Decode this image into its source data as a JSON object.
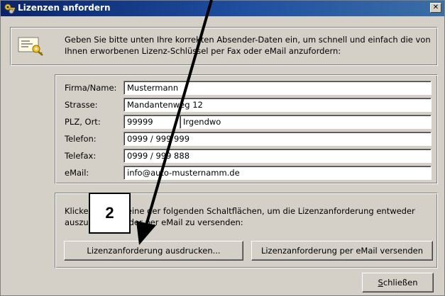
{
  "window": {
    "title": "Lizenzen anfordern",
    "close_glyph": "✕"
  },
  "info": {
    "icon": "license-key-icon",
    "text": "Geben Sie bitte unten Ihre korrekten Absender-Daten ein, um schnell und einfach die von Ihnen erworbenen Lizenz-Schlüssel per Fax oder eMail anzufordern:"
  },
  "form": {
    "firma_label": "Firma/Name:",
    "firma_value": "Mustermann",
    "strasse_label": "Strasse:",
    "strasse_value": "Mandantenweg 12",
    "plz_ort_label": "PLZ, Ort:",
    "plz_value": "99999",
    "ort_value": "Irgendwo",
    "telefon_label": "Telefon:",
    "telefon_value": "0999 / 999 999",
    "telefax_label": "Telefax:",
    "telefax_value": "0999 / 999 888",
    "email_label": "eMail:",
    "email_value": "info@auto-musternamm.de"
  },
  "actions": {
    "instruction_text": "Klicken Sie auf eine der folgenden Schaltflächen, um die Lizenzanforderung entweder auszudrucken oder per eMail zu versenden:",
    "print_button": "Lizenzanforderung ausdrucken...",
    "email_button": "Lizenzanforderung per eMail versenden"
  },
  "footer": {
    "close_button_mnemonic": "S",
    "close_button_rest": "chließen"
  },
  "annotation": {
    "callout_number": "2"
  }
}
